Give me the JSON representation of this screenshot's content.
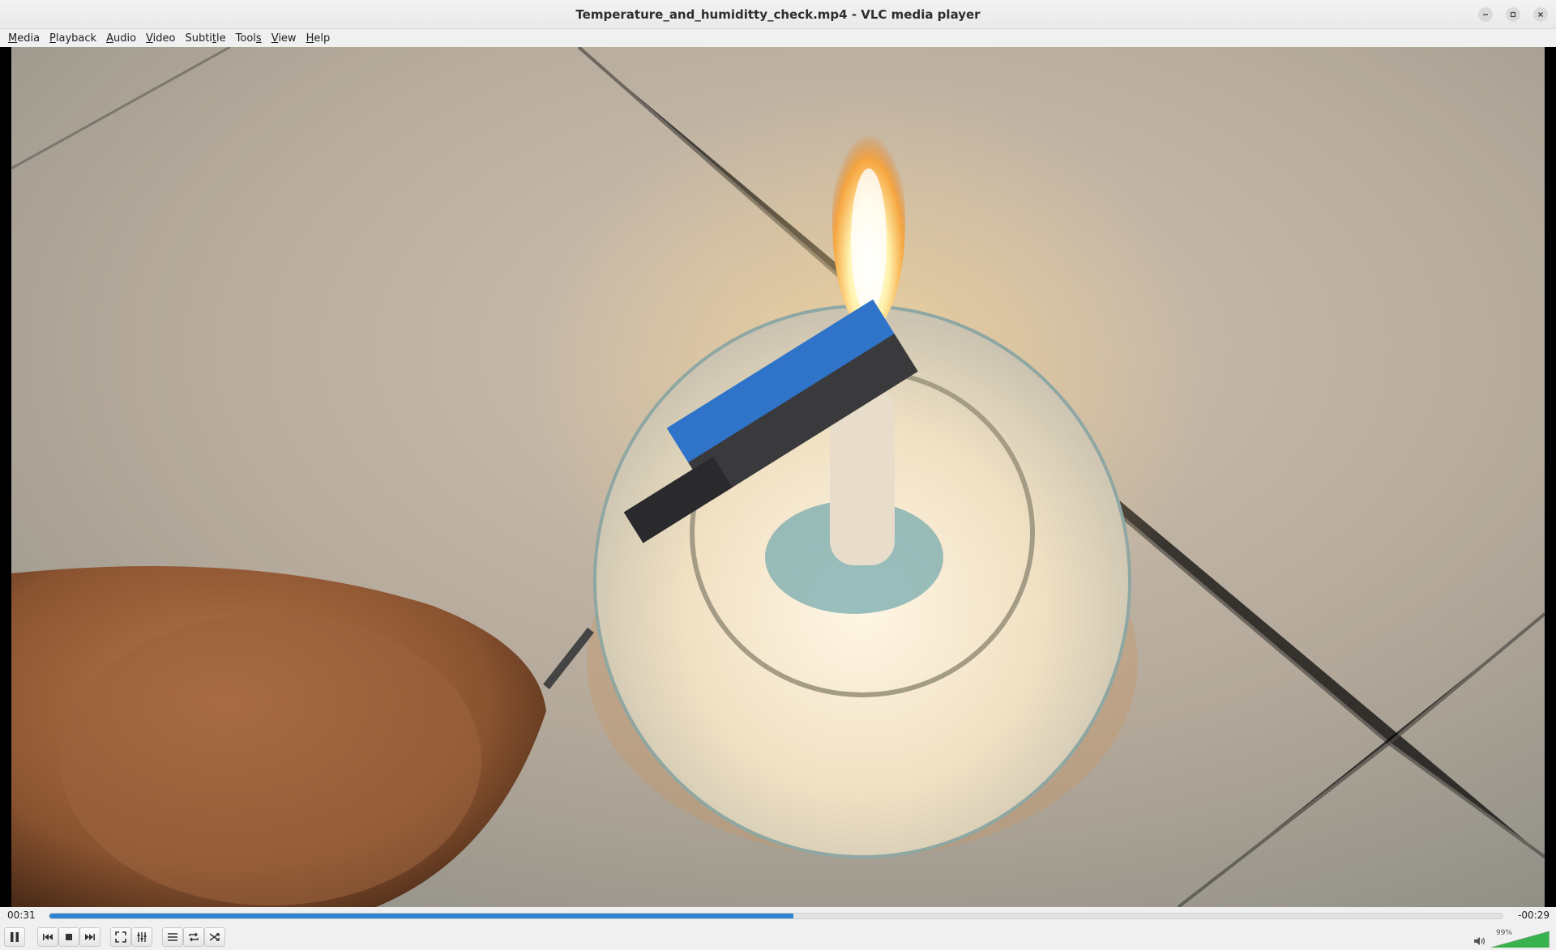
{
  "window": {
    "title": "Temperature_and_humiditty_check.mp4 - VLC media player"
  },
  "menubar": {
    "items": [
      {
        "label": "Media",
        "mnemonic": "M",
        "rest": "edia"
      },
      {
        "label": "Playback",
        "mnemonic": "P",
        "rest": "layback"
      },
      {
        "label": "Audio",
        "mnemonic": "A",
        "rest": "udio"
      },
      {
        "label": "Video",
        "mnemonic": "V",
        "rest": "ideo"
      },
      {
        "label": "Subtitle",
        "pre": "Subti",
        "mnemonic": "t",
        "rest": "le"
      },
      {
        "label": "Tools",
        "pre": "Tool",
        "mnemonic": "s",
        "rest": ""
      },
      {
        "label": "View",
        "mnemonic": "V",
        "rest": "iew"
      },
      {
        "label": "Help",
        "mnemonic": "H",
        "rest": "elp"
      }
    ]
  },
  "playback": {
    "elapsed": "00:31",
    "remaining": "-00:29",
    "progress_fraction": 0.512
  },
  "volume": {
    "label": "99%",
    "level_fraction": 0.99
  },
  "colors": {
    "accent": "#2e84d2",
    "volume_green": "#37b24d"
  },
  "icons": {
    "controls": [
      "pause-icon",
      "previous-icon",
      "stop-icon",
      "next-icon",
      "fullscreen-icon",
      "extended-settings-icon",
      "playlist-icon",
      "loop-icon",
      "shuffle-icon"
    ],
    "window": [
      "minimize-icon",
      "maximize-icon",
      "close-icon"
    ],
    "volume": "speaker-icon"
  }
}
